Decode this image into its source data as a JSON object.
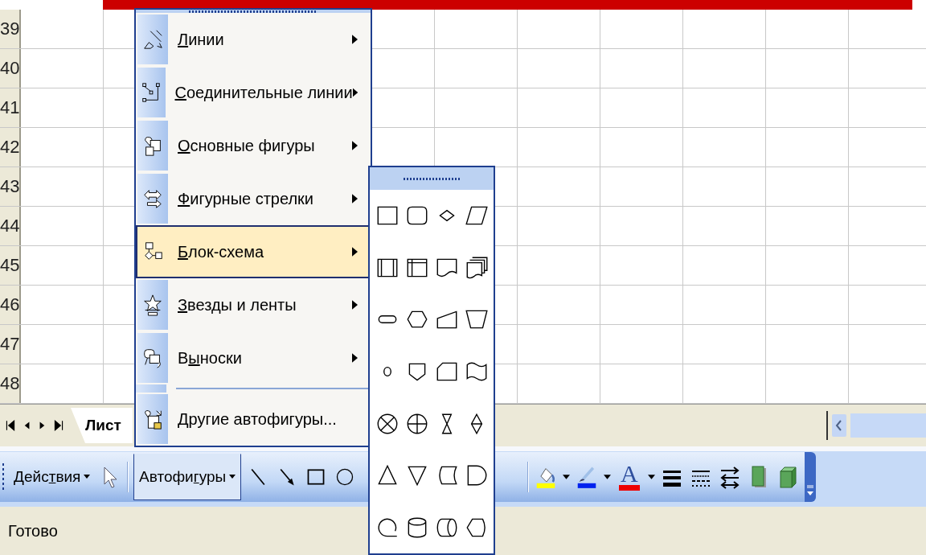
{
  "row_headers": [
    "39",
    "40",
    "41",
    "42",
    "43",
    "44",
    "45",
    "46",
    "47",
    "48"
  ],
  "sheet_tab": {
    "label": "Лист",
    "selected": true
  },
  "autoshapes_menu": {
    "items": [
      {
        "label": "Линии",
        "submenu": true,
        "selected": false,
        "separator_before": false
      },
      {
        "label": "Соединительные линии",
        "submenu": true,
        "selected": false,
        "separator_before": false
      },
      {
        "label": "Основные фигуры",
        "submenu": true,
        "selected": false,
        "separator_before": false
      },
      {
        "label": "Фигурные стрелки",
        "submenu": true,
        "selected": false,
        "separator_before": false
      },
      {
        "label": "Блок-схема",
        "submenu": true,
        "selected": true,
        "separator_before": false
      },
      {
        "label": "Звезды и ленты",
        "submenu": true,
        "selected": false,
        "separator_before": false
      },
      {
        "label": "Выноски",
        "submenu": true,
        "selected": false,
        "separator_before": false
      },
      {
        "label": "Другие автофигуры...",
        "submenu": false,
        "selected": false,
        "separator_before": true
      }
    ]
  },
  "toolbar": {
    "actions": {
      "label": "Действия"
    },
    "autoshapes": {
      "label": "Автофигуры",
      "open": true
    },
    "font_color_glyph": "A"
  },
  "status_bar": {
    "text": "Готово"
  }
}
